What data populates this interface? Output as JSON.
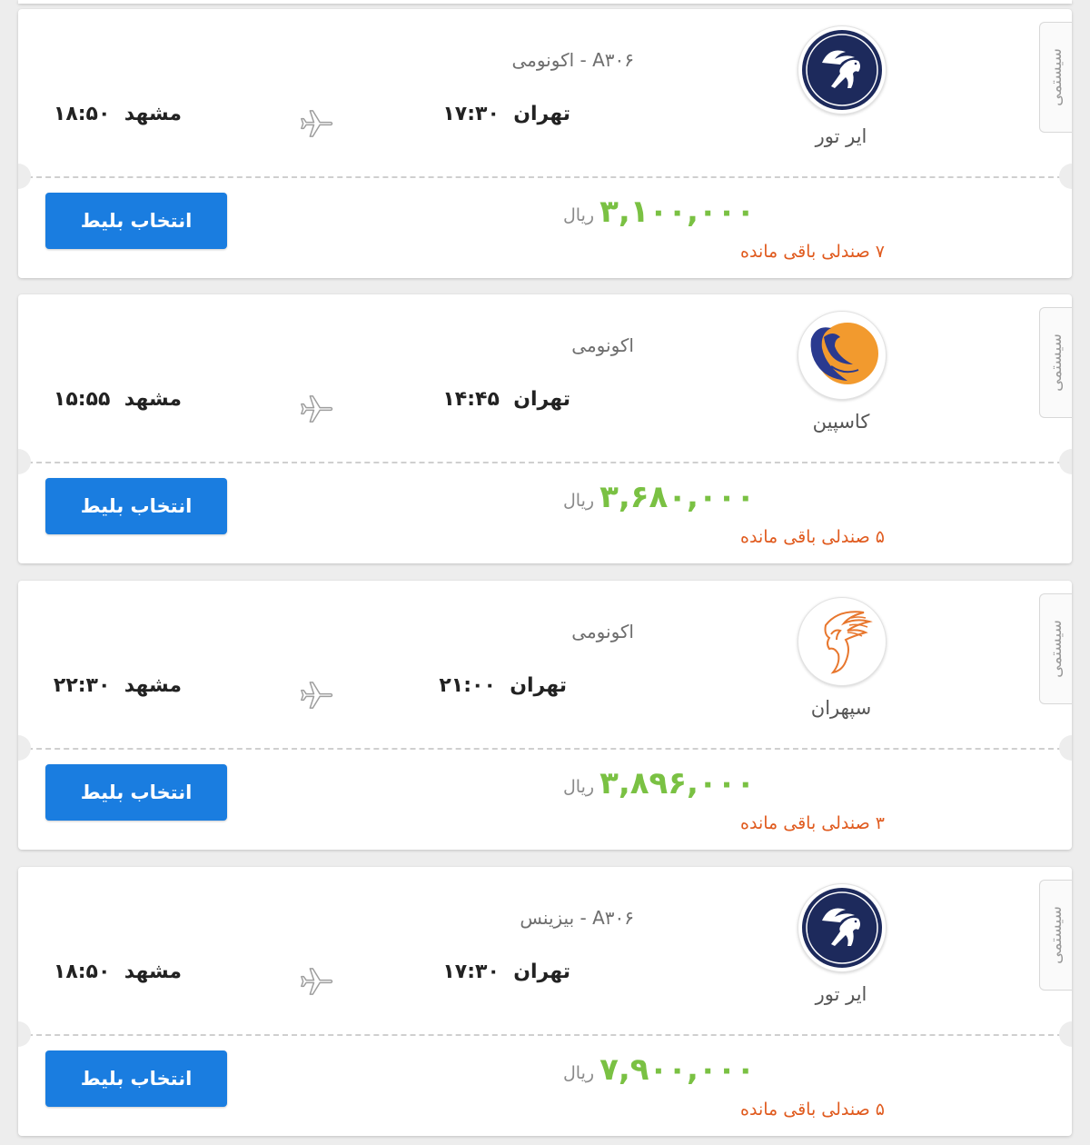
{
  "flights": [
    {
      "tag": "سیستمی",
      "airline": "ایر تور",
      "logo": "airtour-pegasus-logo",
      "flight_info": "A۳۰۶ - اکونومی",
      "origin_city": "تهران",
      "origin_time": "۱۷:۳۰",
      "dest_city": "مشهد",
      "dest_time": "۱۸:۵۰",
      "price": "۳,۱۰۰,۰۰۰",
      "currency": "ریال",
      "seats": "۷ صندلی باقی مانده",
      "button_label": "انتخاب بلیط"
    },
    {
      "tag": "سیستمی",
      "airline": "کاسپین",
      "logo": "caspian-bird-logo",
      "flight_info": "اکونومی",
      "origin_city": "تهران",
      "origin_time": "۱۴:۴۵",
      "dest_city": "مشهد",
      "dest_time": "۱۵:۵۵",
      "price": "۳,۶۸۰,۰۰۰",
      "currency": "ریال",
      "seats": "۵ صندلی باقی مانده",
      "button_label": "انتخاب بلیط"
    },
    {
      "tag": "سیستمی",
      "airline": "سپهران",
      "logo": "sepehran-phoenix-logo",
      "flight_info": "اکونومی",
      "origin_city": "تهران",
      "origin_time": "۲۱:۰۰",
      "dest_city": "مشهد",
      "dest_time": "۲۲:۳۰",
      "price": "۳,۸۹۶,۰۰۰",
      "currency": "ریال",
      "seats": "۳ صندلی باقی مانده",
      "button_label": "انتخاب بلیط"
    },
    {
      "tag": "سیستمی",
      "airline": "ایر تور",
      "logo": "airtour-pegasus-logo",
      "flight_info": "A۳۰۶ - بیزینس",
      "origin_city": "تهران",
      "origin_time": "۱۷:۳۰",
      "dest_city": "مشهد",
      "dest_time": "۱۸:۵۰",
      "price": "۷,۹۰۰,۰۰۰",
      "currency": "ریال",
      "seats": "۵ صندلی باقی مانده",
      "button_label": "انتخاب بلیط"
    }
  ],
  "colors": {
    "price": "#7ac143",
    "seats": "#e05b1f",
    "button": "#1a7de0",
    "airtour_logo": "#1d2a5c",
    "caspian_logo_sun": "#f29a2e",
    "caspian_logo_bird": "#2a3a8f",
    "sepehran_logo": "#e8772e"
  }
}
